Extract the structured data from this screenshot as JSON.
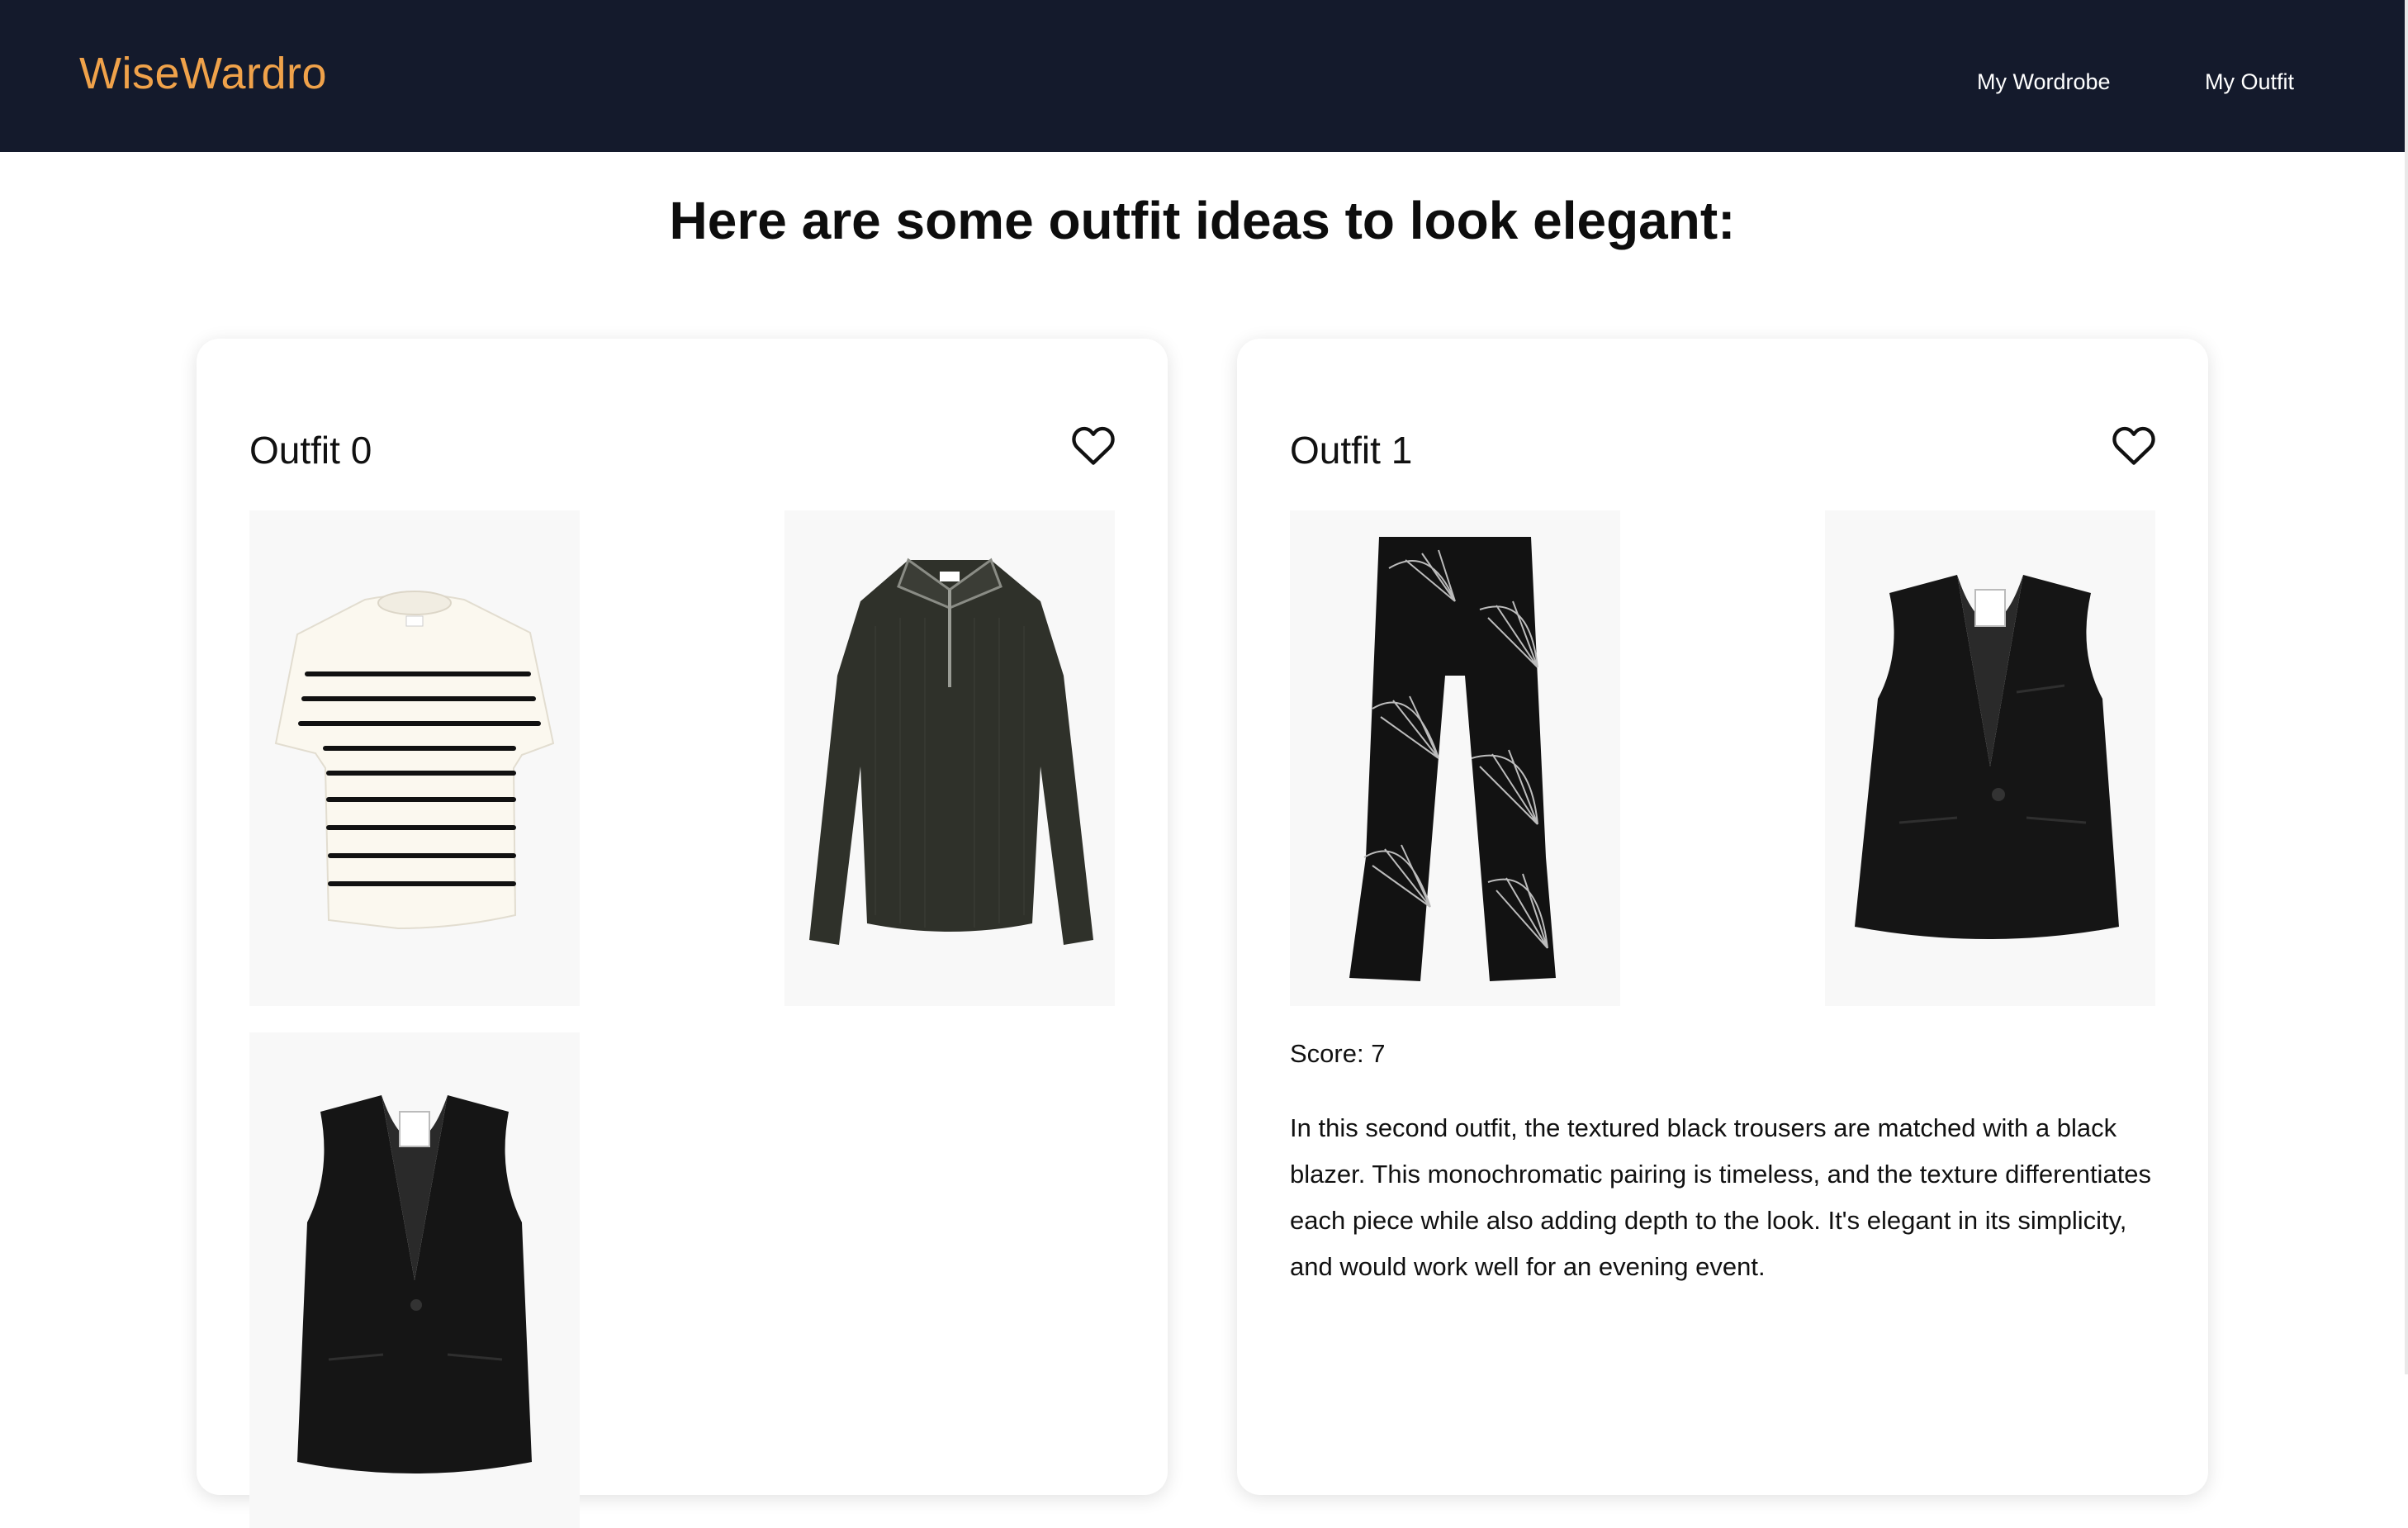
{
  "nav": {
    "brand": "WiseWardro",
    "links": [
      "My Wordrobe",
      "My Outfit"
    ]
  },
  "heading": "Here are some outfit ideas to look elegant:",
  "outfits": [
    {
      "title": "Outfit 0",
      "items": [
        "striped-short-sleeve-knit-top",
        "dark-zip-polo-sweater",
        "black-tailored-waistcoat"
      ],
      "favorite_icon": "heart-outline-icon"
    },
    {
      "title": "Outfit 1",
      "items": [
        "black-printed-wide-leg-trousers",
        "black-tailored-waistcoat"
      ],
      "favorite_icon": "heart-outline-icon",
      "score": "Score: 7",
      "description": "In this second outfit, the textured black trousers are matched with a black blazer. This monochromatic pairing is timeless, and the texture differentiates each piece while also adding depth to the look. It's elegant in its simplicity, and would work well for an evening event."
    }
  ],
  "colors": {
    "navbar": "#141a2c",
    "brand": "#f0a24a",
    "nav_text": "#ffffff",
    "card_bg": "#ffffff",
    "item_bg": "#f8f8f8"
  }
}
